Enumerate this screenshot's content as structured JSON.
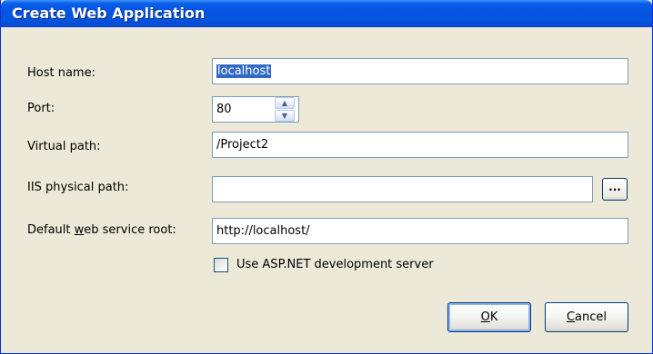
{
  "window": {
    "title": "Create Web Application"
  },
  "form": {
    "host_name": {
      "label": "Host name:",
      "value": "localhost"
    },
    "port": {
      "label": "Port:",
      "value": "80"
    },
    "virtual_path": {
      "label": "Virtual path:",
      "value": "/Project2"
    },
    "iis_path": {
      "label": "IIS physical path:",
      "value": "",
      "browse_label": "..."
    },
    "web_root": {
      "label_pre": "Default ",
      "label_accel": "w",
      "label_post": "eb service root:",
      "value": "http://localhost/"
    },
    "dev_server": {
      "label": "Use ASP.NET development server",
      "checked": false
    }
  },
  "buttons": {
    "ok": {
      "accel": "O",
      "rest": "K"
    },
    "cancel": {
      "accel": "C",
      "rest": "ancel"
    }
  },
  "icons": {
    "spin_up": "spinner-up-icon",
    "spin_down": "spinner-down-icon"
  },
  "colors": {
    "titlebar": "#0554e3",
    "selection": "#316ac5",
    "dialog_bg": "#ece9d8"
  }
}
